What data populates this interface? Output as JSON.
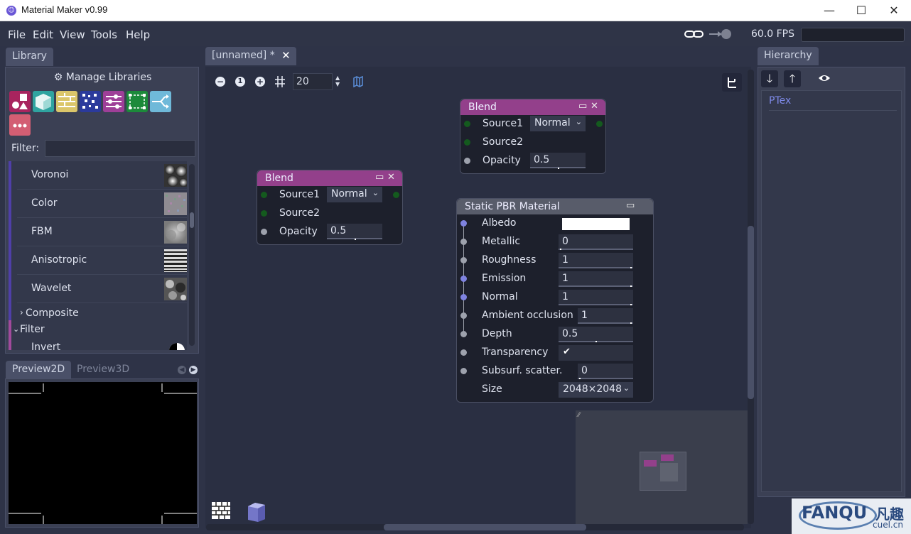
{
  "window": {
    "title": "Material Maker v0.99",
    "logo_glyph": "☺",
    "min": "—",
    "max": "☐",
    "close": "✕"
  },
  "menu": [
    "File",
    "Edit",
    "View",
    "Tools",
    "Help"
  ],
  "fps": "60.0 FPS",
  "library": {
    "tab": "Library",
    "manage": "Manage Libraries",
    "filter_label": "Filter:",
    "filter_value": "",
    "categories": [
      {
        "name": "simple",
        "color": "#a8245e"
      },
      {
        "name": "3d",
        "color": "#2fa4a0"
      },
      {
        "name": "pattern",
        "color": "#dbc66a"
      },
      {
        "name": "noise",
        "color": "#2b3a9c"
      },
      {
        "name": "filter",
        "color": "#9e3f98"
      },
      {
        "name": "transform",
        "color": "#1c8a3a"
      },
      {
        "name": "workflow",
        "color": "#6fb9d9"
      },
      {
        "name": "misc",
        "color": "#d35e73"
      }
    ],
    "items": [
      "Voronoi",
      "Color",
      "FBM",
      "Anisotropic",
      "Wavelet"
    ],
    "composite": "Composite",
    "filter_group": "Filter",
    "partial_item": "Invert"
  },
  "preview": {
    "tab_2d": "Preview2D",
    "tab_3d": "Preview3D"
  },
  "graph": {
    "tab": "[unnamed] *",
    "zoom_value": "20",
    "blend_a": {
      "title": "Blend",
      "rows": [
        {
          "label": "Source1",
          "value": "Normal"
        },
        {
          "label": "Source2"
        },
        {
          "label": "Opacity",
          "value": "0.5",
          "fill": 0.5
        }
      ]
    },
    "blend_b": {
      "title": "Blend",
      "rows": [
        {
          "label": "Source1",
          "value": "Normal"
        },
        {
          "label": "Source2"
        },
        {
          "label": "Opacity",
          "value": "0.5",
          "fill": 0.5
        }
      ]
    },
    "pbr": {
      "title": "Static PBR Material",
      "rows": [
        {
          "label": "Albedo",
          "value": "",
          "port": "blue"
        },
        {
          "label": "Metallic",
          "value": "0",
          "fill": 0,
          "port": "gray"
        },
        {
          "label": "Roughness",
          "value": "1",
          "fill": 1,
          "port": "gray"
        },
        {
          "label": "Emission",
          "value": "1",
          "fill": 1,
          "port": "blue"
        },
        {
          "label": "Normal",
          "value": "1",
          "fill": 1,
          "port": "blue"
        },
        {
          "label": "Ambient occlusion",
          "value": "1",
          "fill": 1,
          "port": "gray"
        },
        {
          "label": "Depth",
          "value": "0.5",
          "fill": 0.5,
          "port": "gray"
        },
        {
          "label": "Transparency",
          "checked": true,
          "port": "gray"
        },
        {
          "label": "Subsurf. scatter.",
          "value": "0",
          "fill": 0,
          "port": "gray"
        },
        {
          "label": "Size",
          "value": "2048×2048"
        }
      ]
    }
  },
  "hierarchy": {
    "tab": "Hierarchy",
    "items": [
      "PTex"
    ]
  },
  "watermark": {
    "main": "FANQU",
    "cn": "凡趣",
    "sub": "cuel.cn"
  }
}
